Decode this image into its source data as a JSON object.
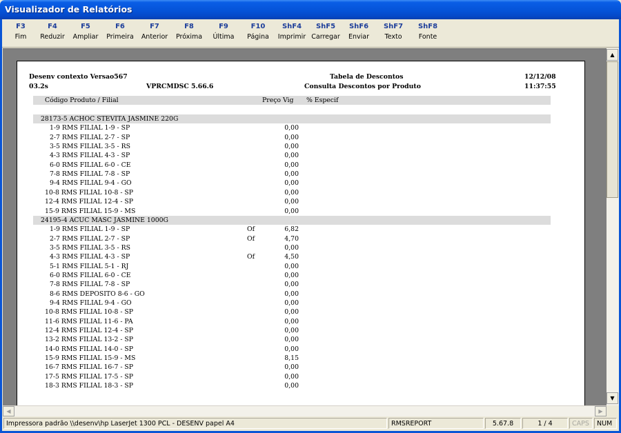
{
  "window": {
    "title": "Visualizador de Relatórios"
  },
  "toolbar": [
    {
      "key": "F3",
      "label": "Fim"
    },
    {
      "key": "F4",
      "label": "Reduzir"
    },
    {
      "key": "F5",
      "label": "Ampliar"
    },
    {
      "key": "F6",
      "label": "Primeira"
    },
    {
      "key": "F7",
      "label": "Anterior"
    },
    {
      "key": "F8",
      "label": "Próxima"
    },
    {
      "key": "F9",
      "label": "Última"
    },
    {
      "key": "F10",
      "label": "Página"
    },
    {
      "key": "ShF4",
      "label": "Imprimir"
    },
    {
      "key": "ShF5",
      "label": "Carregar"
    },
    {
      "key": "ShF6",
      "label": "Enviar"
    },
    {
      "key": "ShF7",
      "label": "Texto"
    },
    {
      "key": "ShF8",
      "label": "Fonte"
    }
  ],
  "report": {
    "header_left_1": "Desenv contexto Versao567",
    "header_center_1": "Tabela de Descontos",
    "header_right_1": "12/12/08",
    "header_left_2": "03.2s",
    "header_module": "VPRCMDSC 5.66.6",
    "header_center_2": "Consulta Descontos por Produto",
    "header_right_2": "11:37:55",
    "col_product": "Código Produto / Filial",
    "col_price": "Preço Vig",
    "col_specific": "% Especif",
    "groups": [
      {
        "product": "28173-5 ACHOC STEVITA JASMINE 220G",
        "rows": [
          {
            "branch": "1-9 RMS FILIAL 1-9 - SP",
            "flag": "",
            "price": "0,00"
          },
          {
            "branch": "2-7 RMS FILIAL 2-7 - SP",
            "flag": "",
            "price": "0,00"
          },
          {
            "branch": "3-5 RMS FILIAL 3-5 - RS",
            "flag": "",
            "price": "0,00"
          },
          {
            "branch": "4-3 RMS FILIAL 4-3 - SP",
            "flag": "",
            "price": "0,00"
          },
          {
            "branch": "6-0 RMS FILIAL 6-0 - CE",
            "flag": "",
            "price": "0,00"
          },
          {
            "branch": "7-8 RMS FILIAL 7-8 - SP",
            "flag": "",
            "price": "0,00"
          },
          {
            "branch": "9-4 RMS FILIAL 9-4 - GO",
            "flag": "",
            "price": "0,00"
          },
          {
            "branch": "10-8 RMS FILIAL 10-8 - SP",
            "flag": "",
            "price": "0,00"
          },
          {
            "branch": "12-4 RMS FILIAL 12-4 - SP",
            "flag": "",
            "price": "0,00"
          },
          {
            "branch": "15-9 RMS FILIAL 15-9 - MS",
            "flag": "",
            "price": "0,00"
          }
        ]
      },
      {
        "product": "24195-4 ACUC MASC JASMINE 1000G",
        "rows": [
          {
            "branch": "1-9 RMS FILIAL 1-9 - SP",
            "flag": "Of",
            "price": "6,82"
          },
          {
            "branch": "2-7 RMS FILIAL 2-7 - SP",
            "flag": "Of",
            "price": "4,70"
          },
          {
            "branch": "3-5 RMS FILIAL 3-5 - RS",
            "flag": "",
            "price": "0,00"
          },
          {
            "branch": "4-3 RMS FILIAL 4-3 - SP",
            "flag": "Of",
            "price": "4,50"
          },
          {
            "branch": "5-1 RMS FILIAL 5-1 - RJ",
            "flag": "",
            "price": "0,00"
          },
          {
            "branch": "6-0 RMS FILIAL 6-0 - CE",
            "flag": "",
            "price": "0,00"
          },
          {
            "branch": "7-8 RMS FILIAL 7-8 - SP",
            "flag": "",
            "price": "0,00"
          },
          {
            "branch": "8-6 RMS DEPOSITO 8-6 - GO",
            "flag": "",
            "price": "0,00"
          },
          {
            "branch": "9-4 RMS FILIAL 9-4 - GO",
            "flag": "",
            "price": "0,00"
          },
          {
            "branch": "10-8 RMS FILIAL 10-8 - SP",
            "flag": "",
            "price": "0,00"
          },
          {
            "branch": "11-6 RMS FILIAL 11-6 - PA",
            "flag": "",
            "price": "0,00"
          },
          {
            "branch": "12-4 RMS FILIAL 12-4 - SP",
            "flag": "",
            "price": "0,00"
          },
          {
            "branch": "13-2 RMS FILIAL 13-2 - SP",
            "flag": "",
            "price": "0,00"
          },
          {
            "branch": "14-0 RMS FILIAL 14-0 - SP",
            "flag": "",
            "price": "0,00"
          },
          {
            "branch": "15-9 RMS FILIAL 15-9 - MS",
            "flag": "",
            "price": "8,15"
          },
          {
            "branch": "16-7 RMS FILIAL 16-7 - SP",
            "flag": "",
            "price": "0,00"
          },
          {
            "branch": "17-5 RMS FILIAL 17-5 - SP",
            "flag": "",
            "price": "0,00"
          },
          {
            "branch": "18-3 RMS FILIAL 18-3 - SP",
            "flag": "",
            "price": "0,00"
          }
        ]
      }
    ]
  },
  "status": {
    "printer": "Impressora padrão \\\\desenv\\hp LaserJet 1300 PCL - DESENV papel A4",
    "app": "RMSREPORT",
    "version": "5.67.8",
    "page": "1 / 4",
    "caps": "CAPS",
    "num": "NUM"
  },
  "icons": {
    "scroll_up": "arrow-up-icon",
    "scroll_down": "arrow-down-icon",
    "scroll_left": "arrow-left-icon",
    "scroll_right": "arrow-right-icon"
  }
}
